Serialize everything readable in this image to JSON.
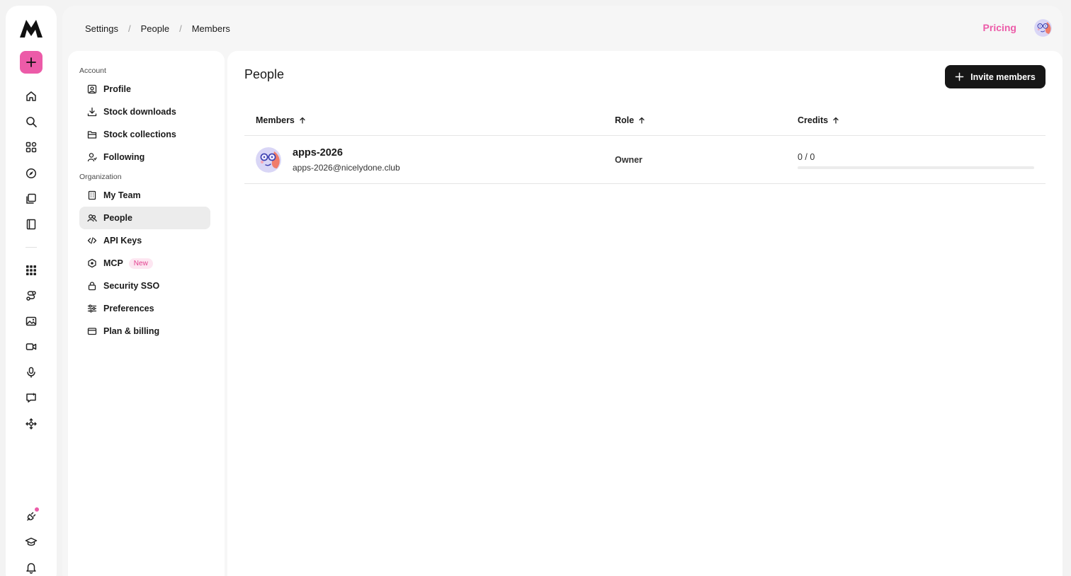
{
  "breadcrumb": [
    "Settings",
    "People",
    "Members"
  ],
  "header": {
    "pricing_label": "Pricing"
  },
  "settings_nav": {
    "account_label": "Account",
    "organization_label": "Organization",
    "account_items": [
      "Profile",
      "Stock downloads",
      "Stock collections",
      "Following"
    ],
    "organization_items": [
      "My Team",
      "People",
      "API Keys",
      "MCP",
      "Security SSO",
      "Preferences",
      "Plan & billing"
    ],
    "active_item": "People",
    "new_badge": "New"
  },
  "page": {
    "title": "People",
    "invite_label": "Invite members"
  },
  "table": {
    "columns": [
      "Members",
      "Role",
      "Credits"
    ],
    "rows": [
      {
        "name": "apps-2026",
        "email": "apps-2026@nicelydone.club",
        "role": "Owner",
        "credits": "0 / 0",
        "credits_used_fraction": 0
      }
    ]
  },
  "colors": {
    "accent": "#ec5ba8",
    "primary_button": "#161616",
    "active_nav": "#ececec"
  },
  "icons": {
    "rail": [
      "home-icon",
      "search-icon",
      "apps-icon",
      "explore-icon",
      "library-icon",
      "book-icon",
      "grid-icon",
      "workflow-icon",
      "image-icon",
      "video-icon",
      "microphone-icon",
      "chat-icon",
      "move-icon",
      "plugin-icon",
      "education-icon",
      "bell-icon"
    ]
  }
}
